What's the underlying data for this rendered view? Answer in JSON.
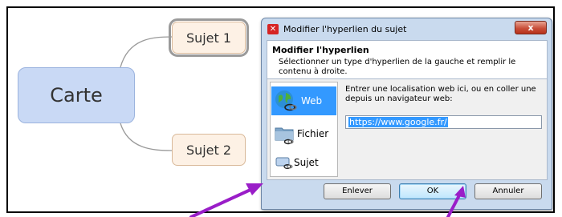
{
  "mindmap": {
    "central": "Carte",
    "topics": [
      "Sujet 1",
      "Sujet 2"
    ]
  },
  "dialog": {
    "title": "Modifier l'hyperlien du sujet",
    "close_glyph": "x",
    "header_title": "Modifier l'hyperlien",
    "header_desc": "Sélectionner un type d'hyperlien de la gauche et remplir le contenu à droite.",
    "types": [
      {
        "label": "Web",
        "icon": "globe-link-icon",
        "selected": true
      },
      {
        "label": "Fichier",
        "icon": "folder-link-icon",
        "selected": false
      },
      {
        "label": "Sujet",
        "icon": "topic-link-icon",
        "selected": false
      }
    ],
    "instruction": "Entrer une localisation web ici, ou en coller une depuis un navigateur web:",
    "url_value": "https://www.google.fr/",
    "buttons": {
      "remove": "Enlever",
      "ok": "OK",
      "cancel": "Annuler"
    }
  },
  "colors": {
    "central_fill": "#c9d9f5",
    "topic_fill": "#fdf1e5",
    "selection": "#3399ff",
    "annotation_arrow": "#9a1ec8"
  }
}
